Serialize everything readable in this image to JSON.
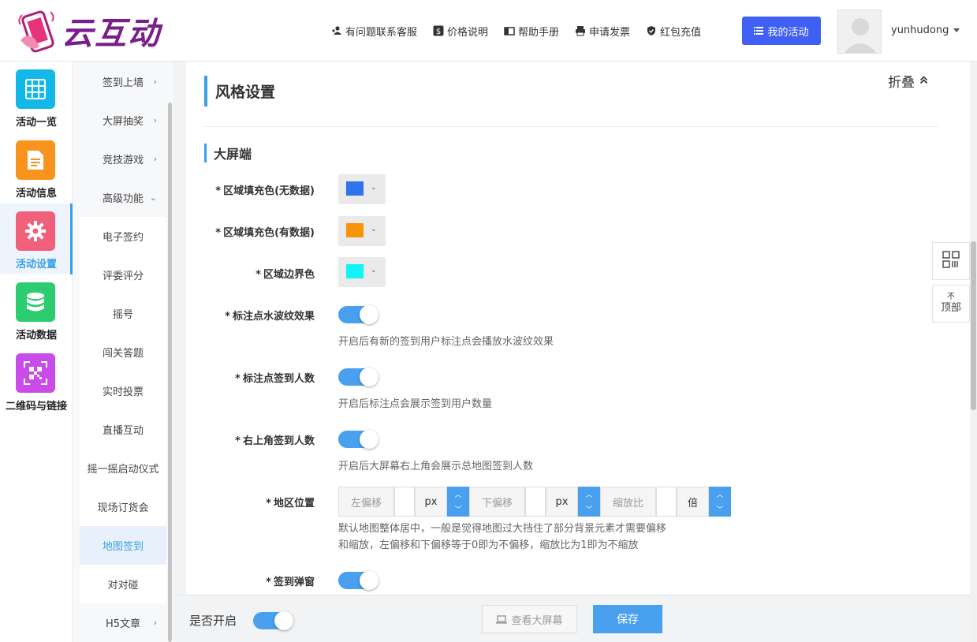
{
  "header": {
    "logo_text": "云互动",
    "nav": [
      {
        "icon": "user-plus-icon",
        "label": "有问题联系客服"
      },
      {
        "icon": "dollar-icon",
        "label": "价格说明"
      },
      {
        "icon": "book-icon",
        "label": "帮助手册"
      },
      {
        "icon": "printer-icon",
        "label": "申请发票"
      },
      {
        "icon": "shield-check-icon",
        "label": "红包充值"
      }
    ],
    "my_activity_label": "我的活动",
    "username": "yunhudong"
  },
  "left_menu": [
    {
      "label": "活动一览",
      "icon": "grid-icon",
      "color": "#12b8e8"
    },
    {
      "label": "活动信息",
      "icon": "document-icon",
      "color": "#f7941d"
    },
    {
      "label": "活动设置",
      "icon": "gear-icon",
      "color": "#f0607a"
    },
    {
      "label": "活动数据",
      "icon": "database-icon",
      "color": "#2ecc71"
    },
    {
      "label": "二维码与链接",
      "icon": "qrcode-icon",
      "color": "#c94be8"
    }
  ],
  "sub_menu": [
    {
      "label": "签到上墙",
      "arrow": "›"
    },
    {
      "label": "大屏抽奖",
      "arrow": "›"
    },
    {
      "label": "竞技游戏",
      "arrow": "›"
    },
    {
      "label": "高级功能",
      "arrow": "⌄"
    },
    {
      "label": "电子签约",
      "arrow": ""
    },
    {
      "label": "评委评分",
      "arrow": ""
    },
    {
      "label": "摇号",
      "arrow": ""
    },
    {
      "label": "闯关答题",
      "arrow": ""
    },
    {
      "label": "实时投票",
      "arrow": ""
    },
    {
      "label": "直播互动",
      "arrow": ""
    },
    {
      "label": "摇一摇启动仪式",
      "arrow": ""
    },
    {
      "label": "现场订货会",
      "arrow": ""
    },
    {
      "label": "地图签到",
      "arrow": ""
    },
    {
      "label": "对对碰",
      "arrow": ""
    },
    {
      "label": "H5文章",
      "arrow": "›"
    }
  ],
  "section": {
    "title": "风格设置",
    "fold_label": "折叠",
    "subtitle": "大屏端"
  },
  "fields": {
    "fill_nodata": {
      "label": "区域填充色(无数据)",
      "color": "#2f74ed"
    },
    "fill_data": {
      "label": "区域填充色(有数据)",
      "color": "#f7940a"
    },
    "border": {
      "label": "区域边界色",
      "color": "#10f4f8"
    },
    "ripple": {
      "label": "标注点水波纹效果",
      "hint": "开启后有新的签到用户标注点会播放水波纹效果"
    },
    "marker_count": {
      "label": "标注点签到人数",
      "hint": "开启后标注点会展示签到用户数量"
    },
    "corner_count": {
      "label": "右上角签到人数",
      "hint": "开启后大屏幕右上角会展示总地图签到人数"
    },
    "position": {
      "label": "地区位置",
      "left_offset": "左偏移",
      "down_offset": "下偏移",
      "scale": "缩放比",
      "unit_px": "px",
      "unit_times": "倍",
      "hint_line1": "默认地图整体居中，一般是觉得地图过大挡住了部分背景元素才需要偏移",
      "hint_line2": "和缩放，左偏移和下偏移等于0即为不偏移，缩放比为1即为不缩放"
    },
    "popup": {
      "label": "签到弹窗"
    }
  },
  "bottom": {
    "enable_label": "是否开启",
    "view_screen_label": "查看大屏幕",
    "save_label": "保存"
  },
  "float": {
    "top_line1": "不",
    "top_line2": "顶部"
  }
}
